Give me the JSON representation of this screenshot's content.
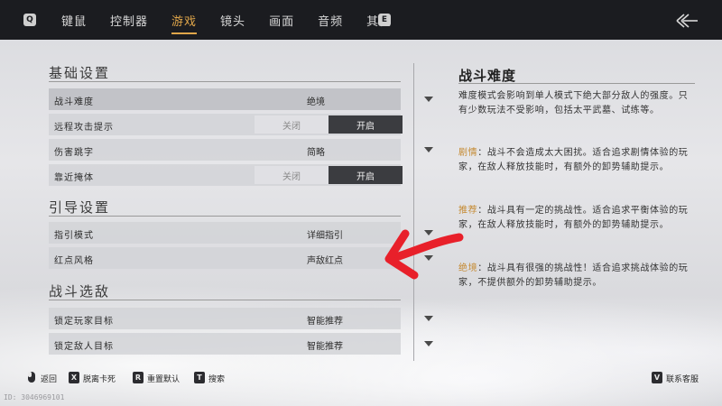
{
  "topbar": {
    "left_key": "Q",
    "right_key": "E",
    "tabs": [
      {
        "label": "键鼠",
        "active": false
      },
      {
        "label": "控制器",
        "active": false
      },
      {
        "label": "游戏",
        "active": true
      },
      {
        "label": "镜头",
        "active": false
      },
      {
        "label": "画面",
        "active": false
      },
      {
        "label": "音频",
        "active": false
      },
      {
        "label": "其他",
        "active": false
      }
    ],
    "back_icon": "back-arrow-icon"
  },
  "sections": {
    "basic": {
      "title": "基础设置",
      "rows": [
        {
          "label": "战斗难度",
          "type": "dropdown",
          "value": "绝境"
        },
        {
          "label": "远程攻击提示",
          "type": "toggle",
          "off_label": "关闭",
          "on_label": "开启",
          "selected": "开启"
        },
        {
          "label": "伤害跳字",
          "type": "dropdown",
          "value": "简略"
        },
        {
          "label": "靠近掩体",
          "type": "toggle",
          "off_label": "关闭",
          "on_label": "开启",
          "selected": "开启"
        }
      ]
    },
    "guide": {
      "title": "引导设置",
      "rows": [
        {
          "label": "指引模式",
          "type": "dropdown",
          "value": "详细指引"
        },
        {
          "label": "红点风格",
          "type": "dropdown",
          "value": "声敌红点"
        }
      ]
    },
    "combat_target": {
      "title": "战斗选敌",
      "rows": [
        {
          "label": "锁定玩家目标",
          "type": "dropdown",
          "value": "智能推荐"
        },
        {
          "label": "锁定敌人目标",
          "type": "dropdown",
          "value": "智能推荐"
        }
      ]
    }
  },
  "detail": {
    "title": "战斗难度",
    "intro": "难度模式会影响到单人模式下绝大部分敌人的强度。只有少数玩法不受影响，包括太平武墓、试练等。",
    "modes": [
      {
        "name": "剧情",
        "sep": "：",
        "desc": "战斗不会造成太大困扰。适合追求剧情体验的玩家，在敌人释放技能时，有额外的卸势辅助提示。"
      },
      {
        "name": "推荐",
        "sep": "：",
        "desc": "战斗具有一定的挑战性。适合追求平衡体验的玩家，在敌人释放技能时，有额外的卸势辅助提示。"
      },
      {
        "name": "绝境",
        "sep": "：",
        "desc": "战斗具有很强的挑战性！适合追求挑战体验的玩家，不提供额外的卸势辅助提示。"
      }
    ],
    "accent_color": "#c58a32"
  },
  "footer": {
    "back": {
      "key": "",
      "label": "返回"
    },
    "unstuck": {
      "key": "X",
      "label": "脱离卡死"
    },
    "reset": {
      "key": "R",
      "label": "重置默认"
    },
    "search": {
      "key": "T",
      "label": "搜索"
    },
    "support": {
      "key": "V",
      "label": "联系客服"
    },
    "uid": "ID: 3046969101"
  },
  "annotation": {
    "arrow_color": "#e8202a"
  }
}
